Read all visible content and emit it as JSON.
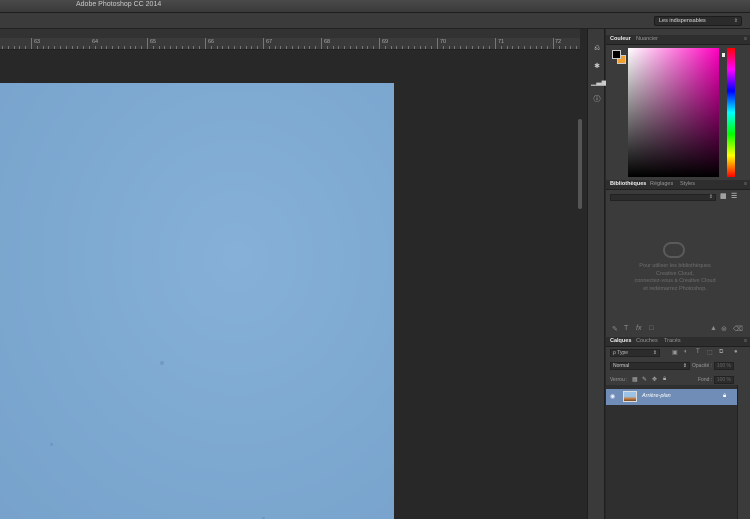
{
  "window": {
    "title": "Adobe Photoshop CC 2014"
  },
  "options_bar": {
    "workspace": "Les indispensables"
  },
  "ruler": {
    "labels": [
      "63",
      "64",
      "65",
      "66",
      "67",
      "68",
      "69",
      "70",
      "71",
      "72"
    ]
  },
  "colors": {
    "foreground": "#000000",
    "background": "#f0a030",
    "image_fill": "#7da8d0",
    "selected_layer": "#6f8db6"
  },
  "color_panel": {
    "tabs": [
      "Couleur",
      "Nuancier"
    ]
  },
  "libraries_panel": {
    "tabs": [
      "Bibliothèques",
      "Réglages",
      "Styles"
    ],
    "message_lines": [
      "Pour utiliser les bibliothèques",
      "Creative Cloud,",
      "connectez-vous à Creative Cloud",
      "et redémarrez Photoshop."
    ],
    "footer_icons": [
      "brush-icon",
      "text-icon",
      "fx-icon",
      "shape-icon",
      "warning-icon",
      "cc-icon",
      "trash-icon"
    ]
  },
  "layers_panel": {
    "tabs": [
      "Calques",
      "Couches",
      "Tracés"
    ],
    "filter": "ρ Type",
    "blend_mode": "Normal",
    "opacity_label": "Opacité :",
    "opacity_value": "100 %",
    "lock_label": "Verrou :",
    "fill_label": "Fond :",
    "fill_value": "100 %",
    "layers": [
      {
        "name": "Arrière-plan",
        "visible": true,
        "locked": true
      }
    ]
  }
}
